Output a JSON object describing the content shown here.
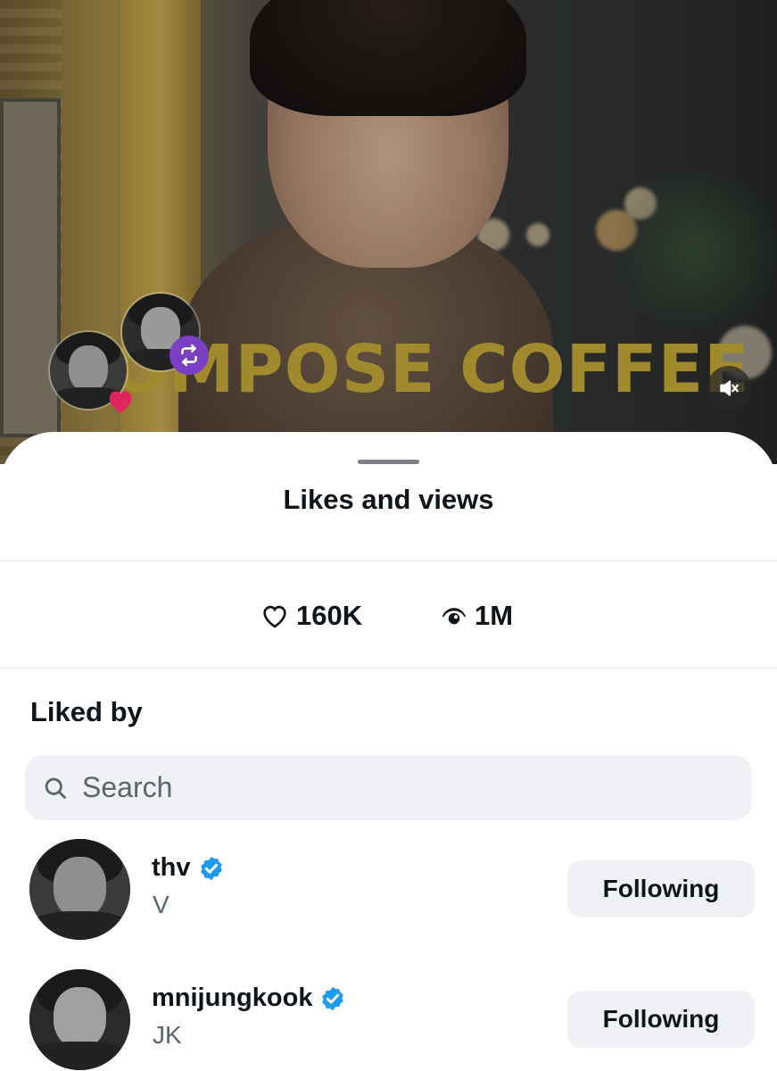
{
  "video": {
    "sign_text": "OMPOSE COFFEE",
    "icons": {
      "mute": "speaker-muted-icon"
    }
  },
  "engagers": {
    "icons": {
      "like": "heart-icon",
      "repost": "repost-icon"
    },
    "colors": {
      "repost_badge": "#7b3fc4",
      "like_badge": "#e0245e"
    }
  },
  "sheet": {
    "title": "Likes and views",
    "stats": {
      "likes": "160K",
      "views": "1M",
      "icons": {
        "likes": "heart-outline-icon",
        "views": "eye-icon"
      }
    },
    "liked_by": {
      "title": "Liked by",
      "search": {
        "placeholder": "Search",
        "icon": "search-icon"
      },
      "users": [
        {
          "handle": "thv",
          "name": "V",
          "verified": true,
          "button": "Following"
        },
        {
          "handle": "mnijungkook",
          "name": "JK",
          "verified": true,
          "button": "Following"
        }
      ]
    }
  },
  "colors": {
    "verified": "#1d9bf0",
    "text_primary": "#0f1419",
    "text_secondary": "#5b6570",
    "button_bg": "#eff1f4",
    "sign_gold": "#a08a2d"
  }
}
